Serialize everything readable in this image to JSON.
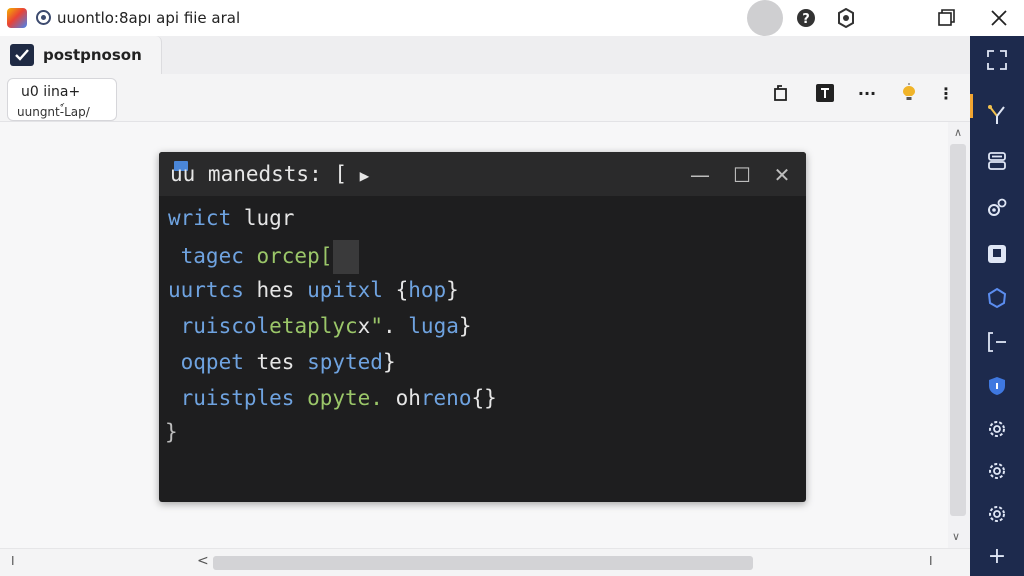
{
  "window": {
    "title": "uuontlo:8apı api fiie aral",
    "icons": [
      "app-logo",
      "gear-icon",
      "user-avatar",
      "help-icon",
      "settings-icon",
      "restore-icon",
      "close-icon"
    ]
  },
  "tab": {
    "label": "postpnoson",
    "icon": "check-icon"
  },
  "info_card": {
    "line1": "u0 iina+",
    "line2": "uungnt-์Lap/"
  },
  "toolbar": {
    "icons": [
      "copy-icon",
      "terminal-icon",
      "more-horizontal-icon",
      "bulb-icon",
      "more-vertical-icon"
    ],
    "more_label": "···",
    "vmore_label": "⋮"
  },
  "terminal": {
    "title": "uu manedsts: [",
    "title_arrow": "▶",
    "controls": {
      "minimize": "—",
      "maximize": "☐",
      "close": "✕"
    },
    "lines": [
      {
        "tokens": [
          {
            "text": "wrict",
            "color": "blue"
          },
          {
            "text": " lugr",
            "color": "white"
          }
        ]
      },
      {
        "tokens": [
          {
            "text": " tagec",
            "color": "blue"
          },
          {
            "text": " orcep[",
            "color": "green"
          }
        ],
        "cursor": true
      },
      {
        "tokens": [
          {
            "text": "uurtcs",
            "color": "blue"
          },
          {
            "text": " hes ",
            "color": "white"
          },
          {
            "text": "upitxl",
            "color": "blue"
          },
          {
            "text": " {",
            "color": "white"
          },
          {
            "text": "hop",
            "color": "blue"
          },
          {
            "text": "}",
            "color": "white"
          }
        ]
      },
      {
        "tokens": [
          {
            "text": " ruiscol",
            "color": "blue"
          },
          {
            "text": "etaplyc",
            "color": "green"
          },
          {
            "text": "x",
            "color": "white"
          },
          {
            "text": "\"",
            "color": "green"
          },
          {
            "text": ".",
            "color": "white"
          },
          {
            "text": " luga",
            "color": "blue"
          },
          {
            "text": "}",
            "color": "white"
          }
        ]
      },
      {
        "tokens": [
          {
            "text": " oqpet",
            "color": "blue"
          },
          {
            "text": " tes ",
            "color": "white"
          },
          {
            "text": "spyted",
            "color": "blue"
          },
          {
            "text": "}",
            "color": "white"
          }
        ]
      },
      {
        "tokens": [
          {
            "text": " ruistples",
            "color": "blue"
          },
          {
            "text": " opyte.",
            "color": "green"
          },
          {
            "text": " oh",
            "color": "white"
          },
          {
            "text": "reno",
            "color": "blue"
          },
          {
            "text": "{}",
            "color": "white"
          }
        ]
      },
      {
        "tokens": [
          {
            "text": "}",
            "color": "grey"
          }
        ]
      }
    ]
  },
  "scrollbars": {
    "up": "∧",
    "down": "∨",
    "left": "<",
    "left_marker": "I",
    "right_marker": "I"
  },
  "sidebar": {
    "icons": [
      "expand-icon",
      "branch-icon",
      "database-icon",
      "settings-group-icon",
      "save-icon",
      "puzzle-icon",
      "split-icon",
      "shield-icon",
      "gear-icon",
      "gear-icon",
      "gear-icon",
      "add-icon"
    ],
    "accent": "#f2a531",
    "background": "#1d2a4d",
    "add_label": "+"
  },
  "colors": {
    "terminal_bg": "#1e1e1f",
    "keyword": "#6fa3e0",
    "string": "#9bc769"
  }
}
